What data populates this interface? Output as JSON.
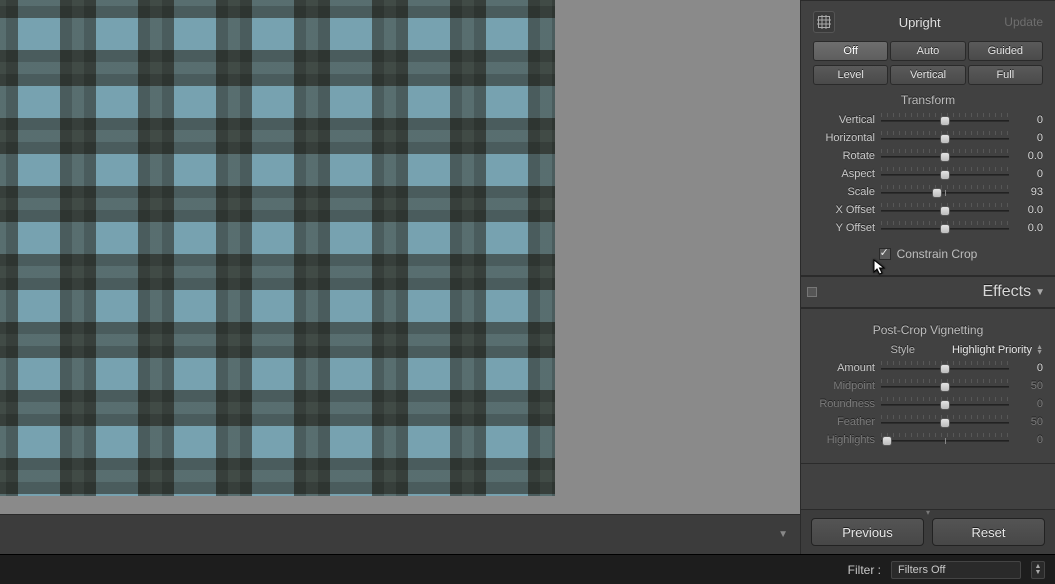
{
  "upright": {
    "label": "Upright",
    "update_label": "Update",
    "modes_row1": [
      "Off",
      "Auto",
      "Guided"
    ],
    "modes_row2": [
      "Level",
      "Vertical",
      "Full"
    ]
  },
  "transform": {
    "title": "Transform",
    "sliders": [
      {
        "label": "Vertical",
        "value": "0",
        "pos": 50
      },
      {
        "label": "Horizontal",
        "value": "0",
        "pos": 50
      },
      {
        "label": "Rotate",
        "value": "0.0",
        "pos": 50
      },
      {
        "label": "Aspect",
        "value": "0",
        "pos": 50
      },
      {
        "label": "Scale",
        "value": "93",
        "pos": 44
      },
      {
        "label": "X Offset",
        "value": "0.0",
        "pos": 50
      },
      {
        "label": "Y Offset",
        "value": "0.0",
        "pos": 50
      }
    ],
    "constrain_crop": {
      "label": "Constrain Crop",
      "checked": true
    }
  },
  "effects": {
    "header": "Effects",
    "vignette_title": "Post-Crop Vignetting",
    "style_label": "Style",
    "style_value": "Highlight Priority",
    "sliders": [
      {
        "label": "Amount",
        "value": "0",
        "pos": 50,
        "dim": false
      },
      {
        "label": "Midpoint",
        "value": "50",
        "pos": 50,
        "dim": true
      },
      {
        "label": "Roundness",
        "value": "0",
        "pos": 50,
        "dim": true
      },
      {
        "label": "Feather",
        "value": "50",
        "pos": 50,
        "dim": true
      },
      {
        "label": "Highlights",
        "value": "0",
        "pos": 5,
        "dim": true
      }
    ]
  },
  "buttons": {
    "previous": "Previous",
    "reset": "Reset"
  },
  "footer": {
    "filter_label": "Filter :",
    "filter_value": "Filters Off"
  }
}
